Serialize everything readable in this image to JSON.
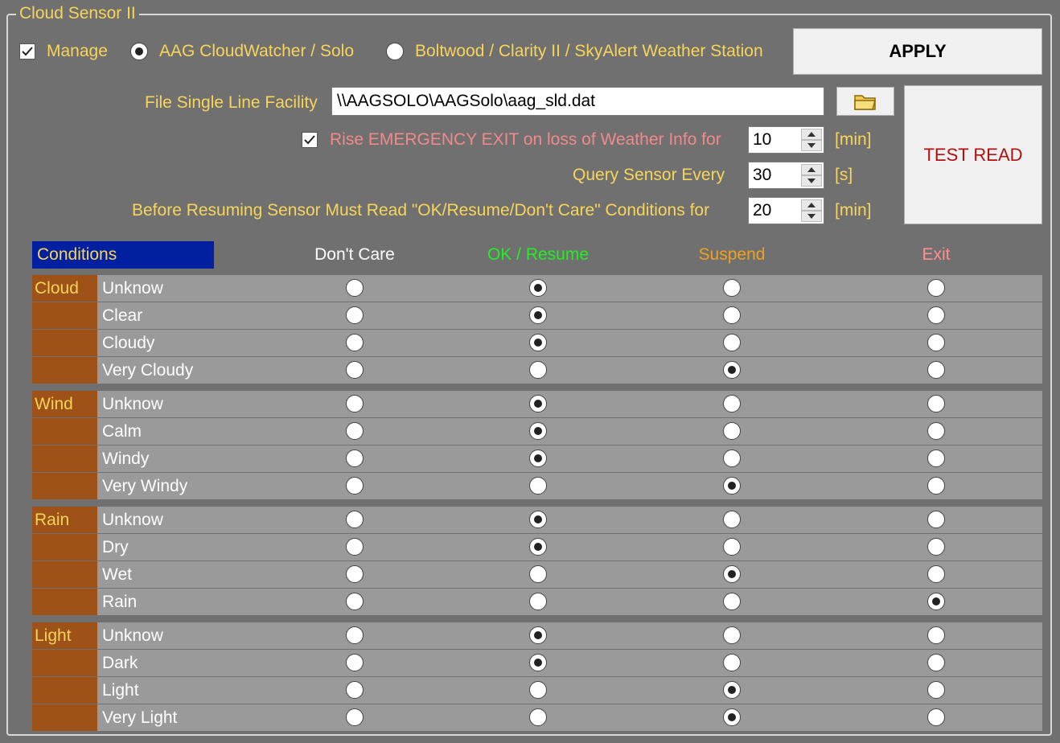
{
  "group": {
    "title": "Cloud Sensor II"
  },
  "header": {
    "manage_label": "Manage",
    "manage_checked": true,
    "sensor_options": [
      "AAG CloudWatcher / Solo",
      "Boltwood / Clarity II / SkyAlert Weather Station"
    ],
    "sensor_selected": 0,
    "apply_label": "APPLY",
    "test_read_label": "TEST READ"
  },
  "settings": {
    "file_label": "File Single Line Facility",
    "file_value": "\\\\AAGSOLO\\AAGSolo\\aag_sld.dat",
    "emergency_label": "Rise EMERGENCY EXIT on loss of Weather Info for",
    "emergency_checked": true,
    "emergency_value": "10",
    "emergency_unit": "[min]",
    "query_label": "Query Sensor Every",
    "query_value": "30",
    "query_unit": "[s]",
    "resume_label": "Before Resuming Sensor Must Read \"OK/Resume/Don't Care\" Conditions for",
    "resume_value": "20",
    "resume_unit": "[min]"
  },
  "conditions": {
    "header": "Conditions",
    "columns": [
      "Don't Care",
      "OK / Resume",
      "Suspend",
      "Exit"
    ],
    "column_colors": [
      "#ffffff",
      "#22ee22",
      "#f0a020",
      "#ff9090"
    ],
    "groups": [
      {
        "name": "Cloud",
        "rows": [
          {
            "label": "Unknow",
            "selected": 1
          },
          {
            "label": "Clear",
            "selected": 1
          },
          {
            "label": "Cloudy",
            "selected": 1
          },
          {
            "label": "Very Cloudy",
            "selected": 2
          }
        ]
      },
      {
        "name": "Wind",
        "rows": [
          {
            "label": "Unknow",
            "selected": 1
          },
          {
            "label": "Calm",
            "selected": 1
          },
          {
            "label": "Windy",
            "selected": 1
          },
          {
            "label": "Very Windy",
            "selected": 2
          }
        ]
      },
      {
        "name": "Rain",
        "rows": [
          {
            "label": "Unknow",
            "selected": 1
          },
          {
            "label": "Dry",
            "selected": 1
          },
          {
            "label": "Wet",
            "selected": 2
          },
          {
            "label": "Rain",
            "selected": 3
          }
        ]
      },
      {
        "name": "Light",
        "rows": [
          {
            "label": "Unknow",
            "selected": 1
          },
          {
            "label": "Dark",
            "selected": 1
          },
          {
            "label": "Light",
            "selected": 2
          },
          {
            "label": "Very Light",
            "selected": 2
          }
        ]
      }
    ]
  }
}
